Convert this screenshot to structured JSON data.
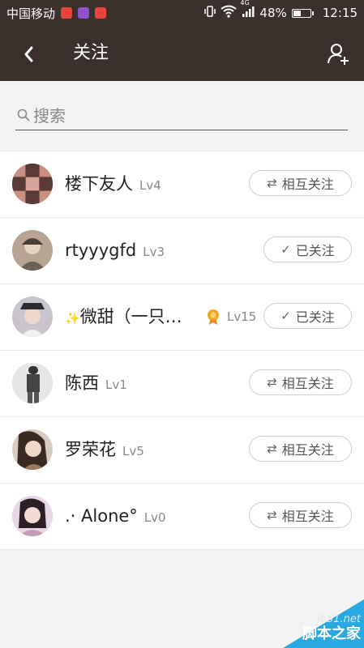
{
  "status_bar": {
    "carrier": "中国移动",
    "network": "4G",
    "battery": "48%",
    "battery_level": 0.48,
    "time": "12:15",
    "app_icon_colors": [
      "#e8453c",
      "#8b52c9",
      "#e8453c"
    ]
  },
  "header": {
    "title": "关注",
    "back_icon": "chevron-left-icon",
    "add_icon": "add-user-icon"
  },
  "search": {
    "placeholder": "搜索"
  },
  "users": [
    {
      "name": "楼下友人",
      "level": "Lv4",
      "button": "相互关注",
      "button_icon": "⇄",
      "state": "mutual",
      "avatar_color": "#8a5a50"
    },
    {
      "name": "rtyyygfd",
      "level": "Lv3",
      "button": "已关注",
      "button_icon": "✓",
      "state": "followed",
      "avatar_color": "#b7a493"
    },
    {
      "name": "微甜（一只…",
      "level": "Lv15",
      "button": "已关注",
      "button_icon": "✓",
      "state": "followed",
      "avatar_color": "#6f6a73",
      "has_medal": true
    },
    {
      "name": "陈西",
      "level": "Lv1",
      "button": "相互关注",
      "button_icon": "⇄",
      "state": "mutual",
      "avatar_color": "#444444"
    },
    {
      "name": "罗荣花",
      "level": "Lv5",
      "button": "相互关注",
      "button_icon": "⇄",
      "state": "mutual",
      "avatar_color": "#9c7b63"
    },
    {
      "name": ".·  Alone°",
      "level": "Lv0",
      "button": "相互关注",
      "button_icon": "⇄",
      "state": "mutual",
      "avatar_color": "#c79ab8"
    }
  ],
  "watermark": {
    "url": "jb51.net",
    "text": "脚本之家"
  },
  "colors": {
    "bar": "#3b302c",
    "background": "#f3f3f3",
    "watermark": "#29a9e1"
  }
}
